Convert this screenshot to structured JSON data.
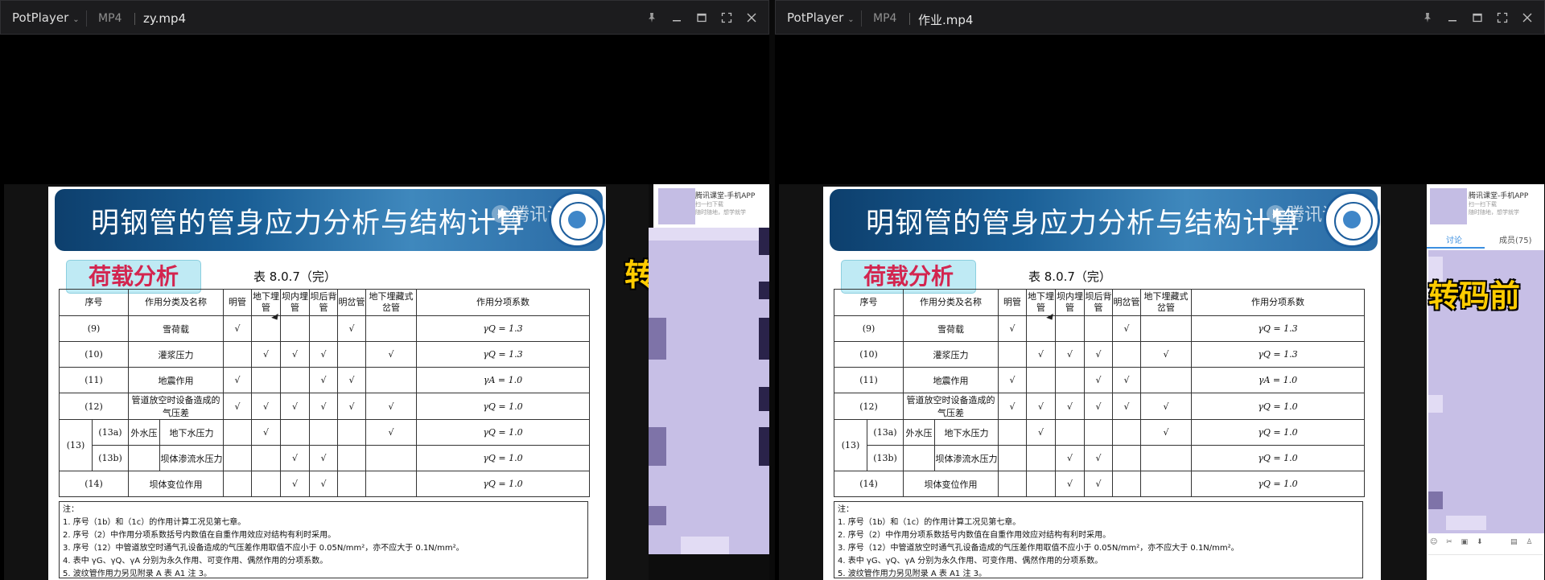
{
  "colors": {
    "titlebar": "#1c1c1e",
    "banner": "#1a5f96",
    "tag_bg": "#bfeaf4",
    "tag_text": "#d3254f",
    "overlay_text": "#ffcc00",
    "panel_purple": "#c7bfe6",
    "accent_blue": "#3b8fe0"
  },
  "players": [
    {
      "app": "PotPlayer",
      "format": "MP4",
      "filename": "zy.mp4",
      "overlay_label": "转码后"
    },
    {
      "app": "PotPlayer",
      "format": "MP4",
      "filename": "作业.mp4",
      "overlay_label": "转码前"
    }
  ],
  "window_controls": [
    {
      "icon": "pin-icon"
    },
    {
      "icon": "minimize-icon"
    },
    {
      "icon": "maximize-icon"
    },
    {
      "icon": "fullscreen-icon"
    },
    {
      "icon": "close-icon"
    }
  ],
  "slide": {
    "title": "明钢管的管身应力分析与结构计算",
    "watermark": "腾讯课",
    "section_tag": "荷载分析",
    "table_caption": "表 8.0.7（完）",
    "headers": [
      "序号",
      "作用分类及名称",
      "明管",
      "地下埋管",
      "坝内埋管",
      "坝后背管",
      "明岔管",
      "地下埋藏式岔管",
      "作用分项系数"
    ],
    "rows": [
      {
        "num": "(9)",
        "name": "雪荷载",
        "marks": [
          "√",
          "",
          "",
          "",
          "√",
          ""
        ],
        "coef": "γQ = 1.3"
      },
      {
        "num": "(10)",
        "name": "灌浆压力",
        "marks": [
          "",
          "√",
          "√",
          "√",
          "",
          "√"
        ],
        "coef": "γQ = 1.3"
      },
      {
        "num": "(11)",
        "name": "地震作用",
        "marks": [
          "√",
          "",
          "",
          "√",
          "√",
          ""
        ],
        "coef": "γA = 1.0"
      },
      {
        "num": "(12)",
        "name": "管道放空时设备造成的气压差",
        "marks": [
          "√",
          "√",
          "√",
          "√",
          "√",
          "√"
        ],
        "coef": "γQ = 1.0"
      }
    ],
    "row13": {
      "num": "(13)",
      "group": "外水压",
      "sub": [
        {
          "num": "(13a)",
          "name": "地下水压力",
          "marks": [
            "",
            "√",
            "",
            "",
            "",
            "√"
          ],
          "coef": "γQ = 1.0"
        },
        {
          "num": "(13b)",
          "name": "坝体渗流水压力",
          "marks": [
            "",
            "",
            "√",
            "√",
            "",
            ""
          ],
          "coef": "γQ = 1.0"
        }
      ]
    },
    "row14": {
      "num": "(14)",
      "name": "坝体变位作用",
      "marks": [
        "",
        "",
        "√",
        "√",
        "",
        ""
      ],
      "coef": "γQ = 1.0"
    },
    "notes": [
      "注：",
      "1.  序号（1b）和（1c）的作用计算工况见第七章。",
      "2.  序号（2）中作用分项系数括号内数值在自重作用效应对结构有利时采用。",
      "3.  序号（12）中管道放空时通气孔设备造成的气压差作用取值不应小于 0.05N/mm²，亦不应大于 0.1N/mm²。",
      "4.  表中 γG、γQ、γA 分别为永久作用、可变作用、偶然作用的分项系数。",
      "5.  波纹管作用力另见附录 A 表 A1 注 3。"
    ]
  },
  "side_panel_left": {
    "app_label": "腾讯课堂-手机APP",
    "sub_line1": "扫一扫下载",
    "sub_line2": "随时随地，想学就学"
  },
  "side_panel_right": {
    "app_label": "腾讯课堂-手机APP",
    "sub_line1": "扫一扫下载",
    "sub_line2": "随时随地，想学就学",
    "tab_discuss": "讨论",
    "tab_members": "成员(75)",
    "icon_row": "☺ ✂ ▣ ⬇",
    "icon_row_right": "▤ ♙"
  }
}
